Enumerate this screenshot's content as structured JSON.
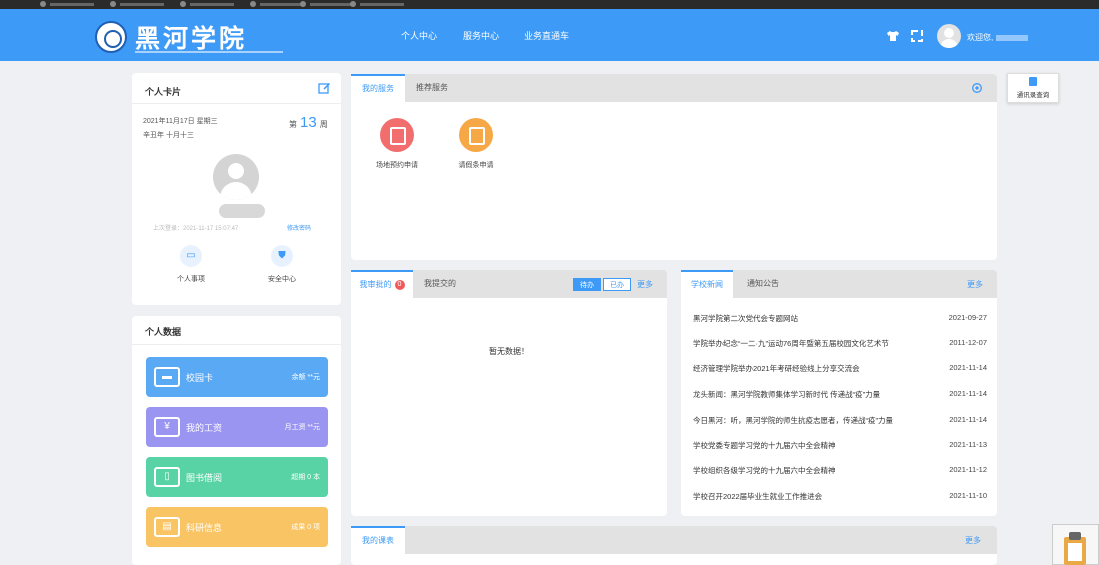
{
  "header": {
    "logo_text": "黑河学院",
    "nav": [
      "个人中心",
      "服务中心",
      "业务直通车"
    ],
    "welcome": "欢迎您,"
  },
  "personal_card": {
    "title": "个人卡片",
    "date": "2021年11月17日 星期三",
    "lunar": "辛丑年 十月十三",
    "week_prefix": "第",
    "week_number": "13",
    "week_suffix": "周",
    "last_login": "上次登录：2021-11-17 15:07:47",
    "change_password": "修改密码",
    "quick_links": [
      "个人事项",
      "安全中心"
    ]
  },
  "personal_info": {
    "title": "个人数据",
    "items": [
      {
        "label": "校园卡",
        "right": "余额 **元",
        "color": "#5aa9f5"
      },
      {
        "label": "我的工资",
        "right": "月工资 **元",
        "color": "#9b95f2"
      },
      {
        "label": "图书借阅",
        "right": "超期 0 本",
        "color": "#58d3a5"
      },
      {
        "label": "科研信息",
        "right": "成果 0 项",
        "color": "#f9c463"
      }
    ]
  },
  "services": {
    "tabs": [
      "我的服务",
      "推荐服务"
    ],
    "items": [
      {
        "label": "场地预约申请",
        "color": "#f26d6d"
      },
      {
        "label": "请假条申请",
        "color": "#f5a845"
      }
    ]
  },
  "tasks": {
    "tabs": [
      "我审批的",
      "我提交的"
    ],
    "badge": "0",
    "toggle": [
      "待办",
      "已办"
    ],
    "more": "更多",
    "empty": "暂无数据！"
  },
  "news": {
    "tabs": [
      "学校新闻",
      "通知公告"
    ],
    "more": "更多",
    "items": [
      {
        "title": "黑河学院第二次党代会专题网站",
        "date": "2021-09-27"
      },
      {
        "title": "学院举办纪念“一二·九”运动76周年暨第五届校园文化艺术节",
        "date": "2011-12-07"
      },
      {
        "title": "经济管理学院举办2021年考研经验线上分享交流会",
        "date": "2021-11-14"
      },
      {
        "title": "龙头新闻：黑河学院教师集体学习新时代 传递战“疫”力量",
        "date": "2021-11-14"
      },
      {
        "title": "今日黑河：听，黑河学院的师生抗疫志愿者，传递战“疫”力量",
        "date": "2021-11-14"
      },
      {
        "title": "学校党委专题学习党的十九届六中全会精神",
        "date": "2021-11-13"
      },
      {
        "title": "学校组织各级学习党的十九届六中全会精神",
        "date": "2021-11-12"
      },
      {
        "title": "学校召开2022届毕业生就业工作推进会",
        "date": "2021-11-10"
      }
    ]
  },
  "courses": {
    "tab": "我的课表",
    "more": "更多"
  },
  "floating": {
    "label": "通讯录查询"
  }
}
